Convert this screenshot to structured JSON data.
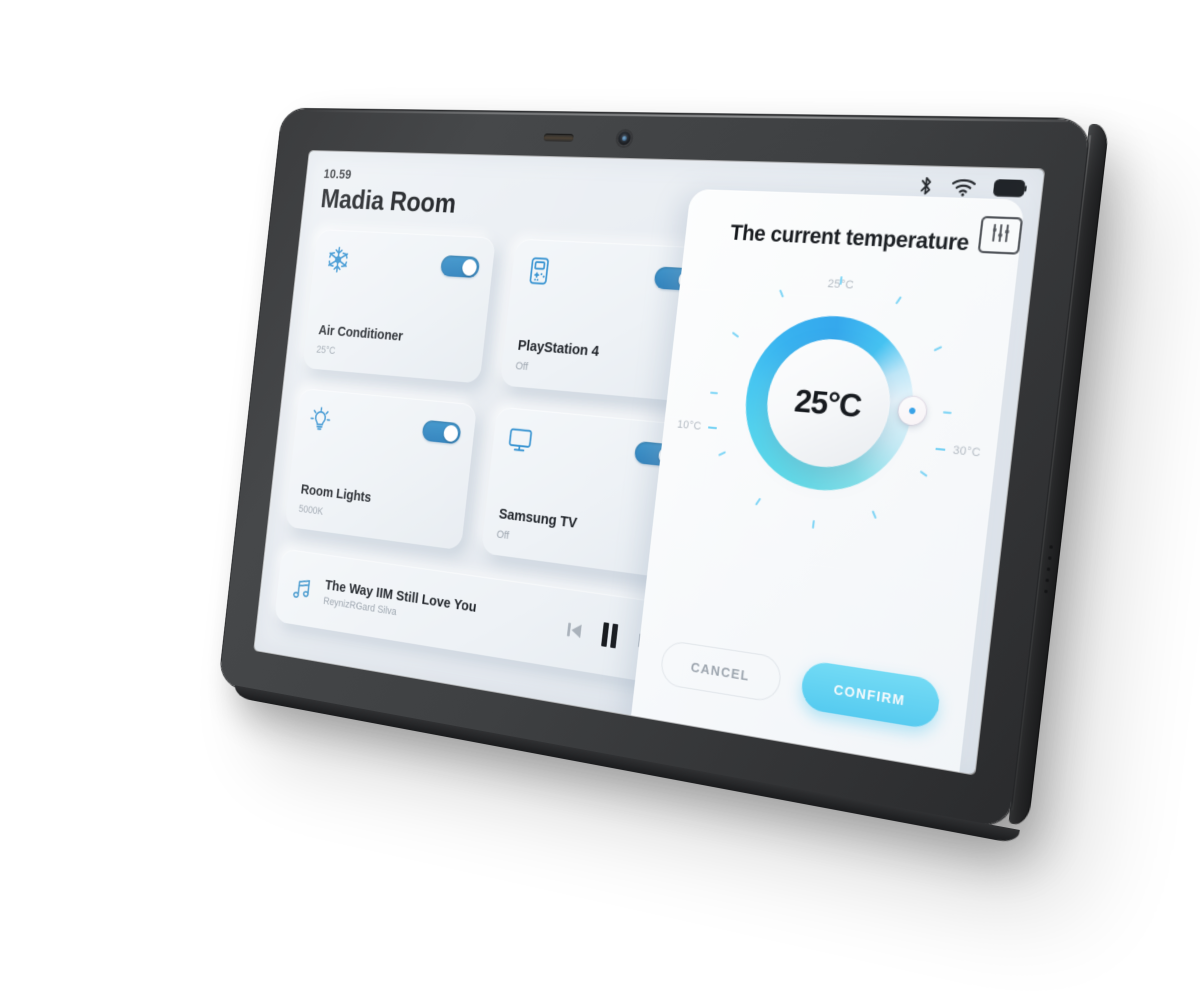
{
  "status_bar": {
    "bluetooth_icon": "bluetooth-icon",
    "wifi_icon": "wifi-icon",
    "battery_icon": "battery-icon",
    "settings_icon": "sliders-icon"
  },
  "header": {
    "time": "10.59",
    "room_title": "Madia Room"
  },
  "devices": [
    {
      "icon": "snowflake-icon",
      "name": "Air Conditioner",
      "status": "25°C",
      "toggle_on": true
    },
    {
      "icon": "gameboy-icon",
      "name": "PlayStation 4",
      "status": "Off",
      "toggle_on": true
    },
    {
      "icon": "lightbulb-icon",
      "name": "Room Lights",
      "status": "5000K",
      "toggle_on": true
    },
    {
      "icon": "monitor-icon",
      "name": "Samsung TV",
      "status": "Off",
      "toggle_on": true
    }
  ],
  "player": {
    "music_icon": "music-note-icon",
    "track_title": "The Way IIM Still Love You",
    "artist": "ReynizRGard Silva",
    "prev_icon": "skip-previous-icon",
    "pause_icon": "pause-icon",
    "next_icon": "skip-next-icon"
  },
  "temperature_panel": {
    "heading": "The current temperature",
    "top_label": "25°C",
    "min_label": "10°C",
    "max_label": "30°C",
    "current_value": "25°C",
    "cancel_label": "CANCEL",
    "confirm_label": "CONFIRM"
  },
  "colors": {
    "accent_blue": "#3e95cc",
    "dial_cyan": "#4ecbf2",
    "dial_blue": "#2fa7ee",
    "screen_bg": "#eaeef2",
    "text_primary": "#15181c",
    "text_muted": "#9aa3ad"
  }
}
